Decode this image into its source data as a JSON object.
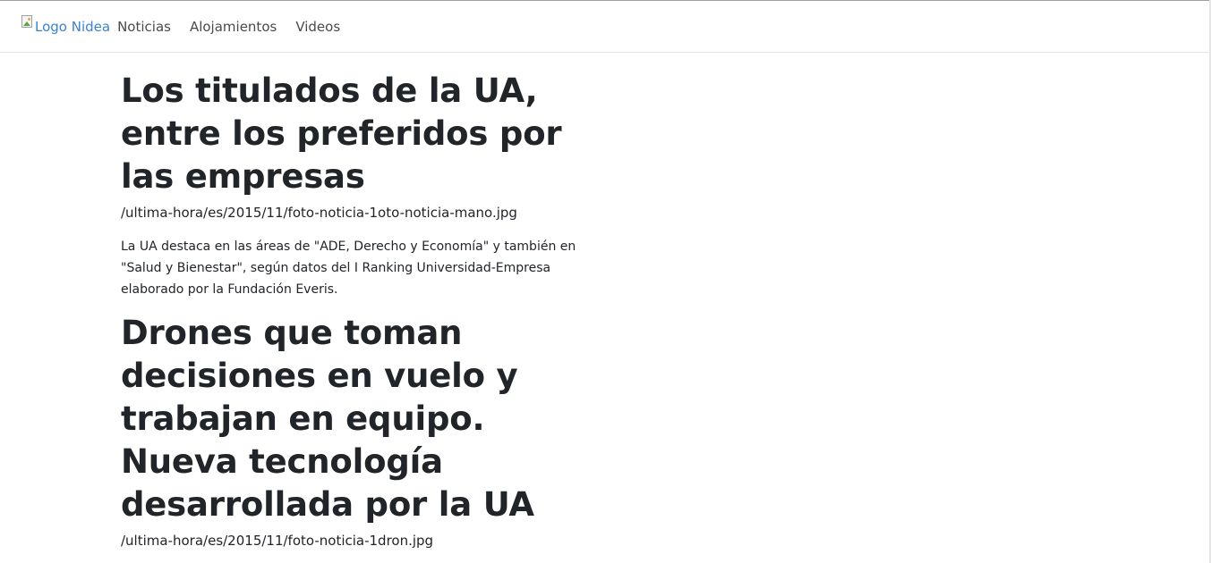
{
  "navbar": {
    "brand_alt": "Logo Nidea",
    "links": [
      {
        "label": "Noticias"
      },
      {
        "label": "Alojamientos"
      },
      {
        "label": "Videos"
      }
    ]
  },
  "articles": [
    {
      "title": "Los titulados de la UA, entre los preferidos por las empresas",
      "image_path": "/ultima-hora/es/2015/11/foto-noticia-1oto-noticia-mano.jpg",
      "summary": "La UA destaca en las áreas de \"ADE, Derecho y Economía\" y también en \"Salud y Bienestar\", según datos del I Ranking Universidad-Empresa elaborado por la Fundación Everis."
    },
    {
      "title": "Drones que toman decisiones en vuelo y trabajan en equipo. Nueva tecnología desarrollada por la UA",
      "image_path": "/ultima-hora/es/2015/11/foto-noticia-1dron.jpg"
    }
  ],
  "colors": {
    "brand_link": "#3b82d6",
    "nav_text": "#4a4a4a",
    "body_text": "#212529"
  }
}
